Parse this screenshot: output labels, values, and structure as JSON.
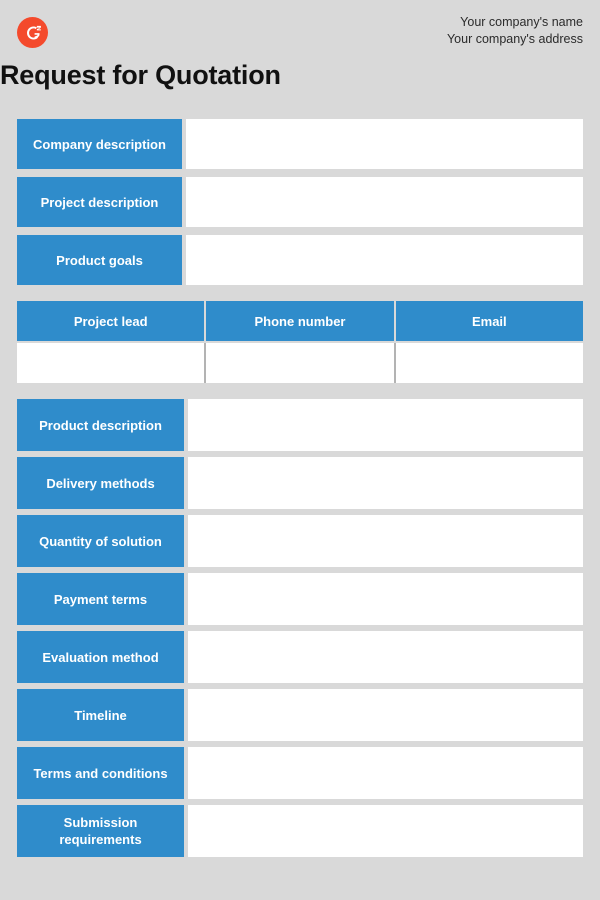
{
  "document": {
    "title": "Request for Quotation",
    "logo_icon": "g2-logo-icon",
    "logo_color": "#f44a2c",
    "accent_color": "#2f8ccb",
    "background_color": "#d9d9d9",
    "field_color": "#ffffff"
  },
  "header": {
    "company_name": "Your company's name",
    "company_address": "Your company's address"
  },
  "top_rows": [
    {
      "label": "Company description",
      "value": ""
    },
    {
      "label": "Project description",
      "value": ""
    },
    {
      "label": "Product goals",
      "value": ""
    }
  ],
  "contact_table": {
    "columns": [
      "Project lead",
      "Phone number",
      "Email"
    ],
    "rows": [
      {
        "project_lead": "",
        "phone_number": "",
        "email": ""
      }
    ]
  },
  "bottom_rows": [
    {
      "label": "Product description",
      "value": ""
    },
    {
      "label": "Delivery methods",
      "value": ""
    },
    {
      "label": "Quantity of solution",
      "value": ""
    },
    {
      "label": "Payment terms",
      "value": ""
    },
    {
      "label": "Evaluation method",
      "value": ""
    },
    {
      "label": "Timeline",
      "value": ""
    },
    {
      "label": "Terms and conditions",
      "value": ""
    },
    {
      "label": "Submission requirements",
      "value": ""
    }
  ]
}
